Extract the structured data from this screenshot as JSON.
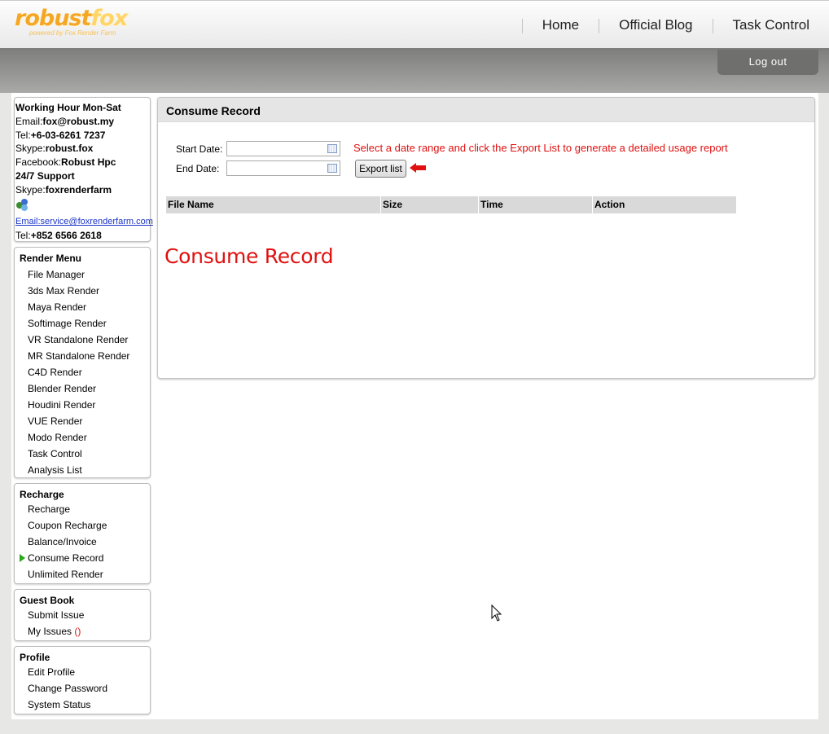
{
  "logo": {
    "brand_a": "robust",
    "brand_b": "fox",
    "tagline": "powered by Fox Render Farm"
  },
  "topnav": [
    "Home",
    "Official Blog",
    "Task Control"
  ],
  "logout_label": "Log out",
  "contact": {
    "working_hour": "Working Hour Mon-Sat",
    "email_label": "Email:",
    "email": "fox@robust.my",
    "tel_label": "Tel:",
    "tel": "+6-03-6261 7237",
    "skype_label": "Skype:",
    "skype": "robust.fox",
    "facebook_label": "Facebook:",
    "facebook": "Robust Hpc",
    "support": "24/7 Support",
    "skype2_label": "Skype:",
    "skype2": "foxrenderfarm",
    "email2": "Email:service@foxrenderfarm.com",
    "tel2_label": "Tel:",
    "tel2": "+852 6566 2618"
  },
  "render_menu": {
    "title": "Render Menu",
    "items": [
      "File Manager",
      "3ds Max Render",
      "Maya Render",
      "Softimage Render",
      "VR Standalone Render",
      "MR Standalone Render",
      "C4D Render",
      "Blender Render",
      "Houdini Render",
      "VUE Render",
      "Modo Render",
      "Task Control",
      "Analysis List"
    ]
  },
  "recharge_menu": {
    "title": "Recharge",
    "items": [
      "Recharge",
      "Coupon Recharge",
      "Balance/Invoice",
      "Consume Record",
      "Unlimited Render"
    ],
    "active": "Consume Record"
  },
  "guestbook_menu": {
    "title": "Guest Book",
    "items": [
      "Submit Issue",
      "My Issues"
    ],
    "issues_count": "()"
  },
  "profile_menu": {
    "title": "Profile",
    "items": [
      "Edit Profile",
      "Change Password",
      "System Status"
    ]
  },
  "panel": {
    "title": "Consume Record",
    "start_label": "Start Date:",
    "end_label": "End Date:",
    "start_value": "",
    "end_value": "",
    "hint": "Select a date range and click the Export List to generate a detailed usage report",
    "export_label": "Export list",
    "columns": [
      "File Name",
      "Size",
      "Time",
      "Action"
    ],
    "big_title": "Consume Record"
  },
  "colors": {
    "accent_red": "#e01010",
    "active_marker": "#2aa81c",
    "logo_orange": "#f5a623"
  }
}
